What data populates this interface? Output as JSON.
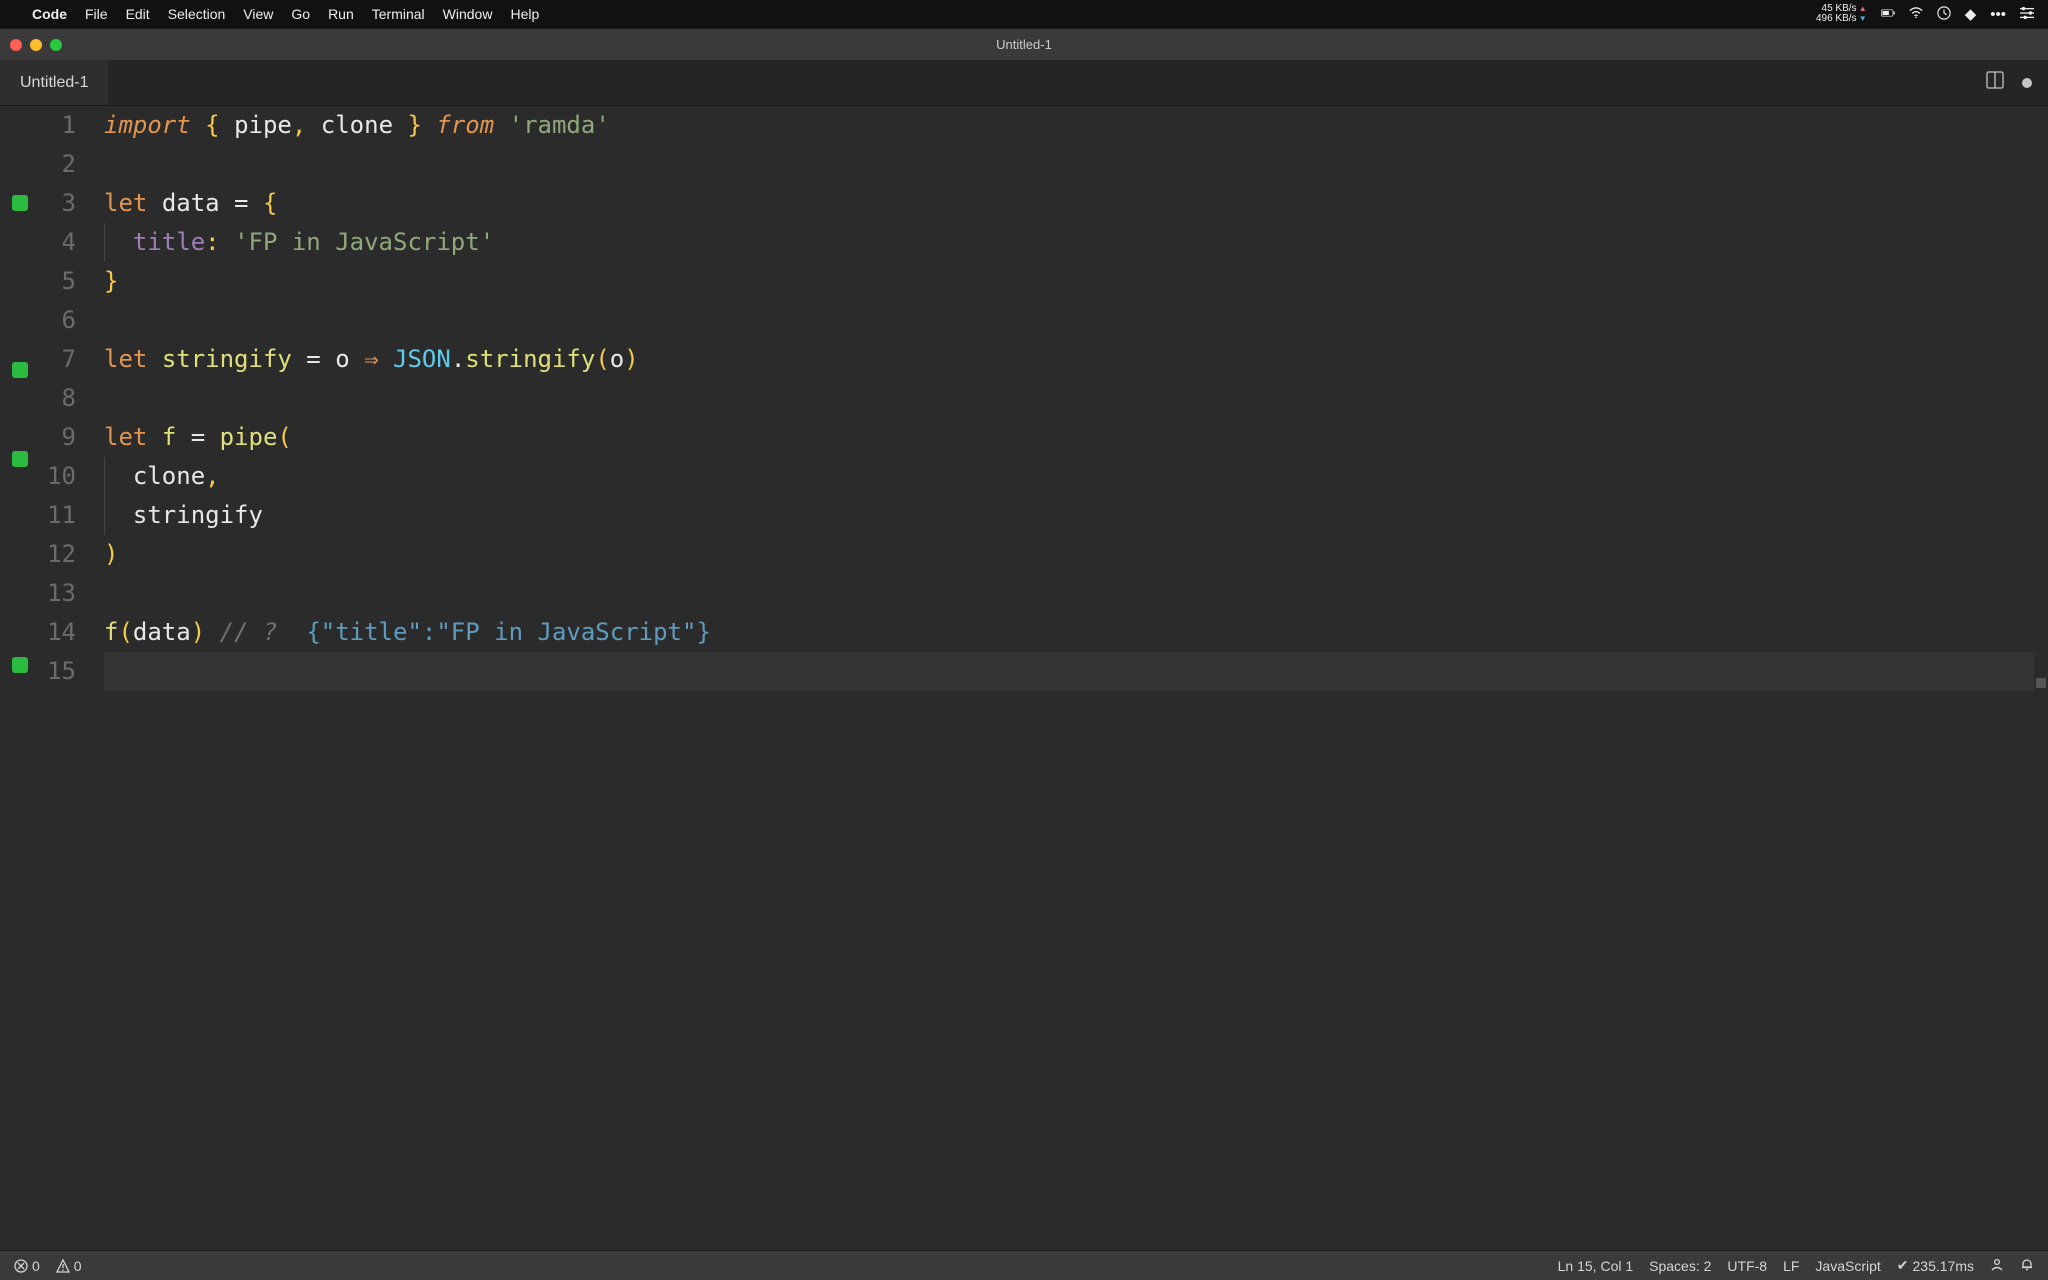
{
  "menubar": {
    "app": "Code",
    "items": [
      "File",
      "Edit",
      "Selection",
      "View",
      "Go",
      "Run",
      "Terminal",
      "Window",
      "Help"
    ],
    "net_up": "45 KB/s",
    "net_down": "496 KB/s"
  },
  "window": {
    "title": "Untitled-1"
  },
  "tabs": {
    "active": "Untitled-1"
  },
  "editor": {
    "lines": [
      {
        "n": 1,
        "mark": false,
        "tokens": [
          [
            "kw",
            "import"
          ],
          [
            "punw",
            " "
          ],
          [
            "pun",
            "{"
          ],
          [
            "punw",
            " "
          ],
          [
            "ident",
            "pipe"
          ],
          [
            "pun",
            ","
          ],
          [
            "punw",
            " "
          ],
          [
            "ident",
            "clone"
          ],
          [
            "punw",
            " "
          ],
          [
            "pun",
            "}"
          ],
          [
            "punw",
            " "
          ],
          [
            "kw",
            "from"
          ],
          [
            "punw",
            " "
          ],
          [
            "str",
            "'ramda'"
          ]
        ]
      },
      {
        "n": 2,
        "mark": false,
        "tokens": []
      },
      {
        "n": 3,
        "mark": true,
        "tokens": [
          [
            "kw2",
            "let"
          ],
          [
            "punw",
            " "
          ],
          [
            "ident",
            "data"
          ],
          [
            "punw",
            " = "
          ],
          [
            "pun",
            "{"
          ]
        ]
      },
      {
        "n": 4,
        "mark": false,
        "indent": 1,
        "tokens": [
          [
            "prop",
            "title"
          ],
          [
            "pun",
            ":"
          ],
          [
            "punw",
            " "
          ],
          [
            "str",
            "'FP in JavaScript'"
          ]
        ]
      },
      {
        "n": 5,
        "mark": false,
        "tokens": [
          [
            "pun",
            "}"
          ]
        ]
      },
      {
        "n": 6,
        "mark": false,
        "tokens": []
      },
      {
        "n": 7,
        "mark": true,
        "tokens": [
          [
            "kw2",
            "let"
          ],
          [
            "punw",
            " "
          ],
          [
            "fn",
            "stringify"
          ],
          [
            "punw",
            " = "
          ],
          [
            "ident",
            "o"
          ],
          [
            "punw",
            " "
          ],
          [
            "arrow",
            "⇒"
          ],
          [
            "punw",
            " "
          ],
          [
            "type",
            "JSON"
          ],
          [
            "punw",
            "."
          ],
          [
            "fn",
            "stringify"
          ],
          [
            "pun",
            "("
          ],
          [
            "ident",
            "o"
          ],
          [
            "pun",
            ")"
          ]
        ]
      },
      {
        "n": 8,
        "mark": false,
        "tokens": []
      },
      {
        "n": 9,
        "mark": true,
        "tokens": [
          [
            "kw2",
            "let"
          ],
          [
            "punw",
            " "
          ],
          [
            "fn",
            "f"
          ],
          [
            "punw",
            " = "
          ],
          [
            "fn",
            "pipe"
          ],
          [
            "pun",
            "("
          ]
        ]
      },
      {
        "n": 10,
        "mark": false,
        "indent": 1,
        "tokens": [
          [
            "ident",
            "clone"
          ],
          [
            "pun",
            ","
          ]
        ]
      },
      {
        "n": 11,
        "mark": false,
        "indent": 1,
        "tokens": [
          [
            "ident",
            "stringify"
          ]
        ]
      },
      {
        "n": 12,
        "mark": false,
        "tokens": [
          [
            "pun",
            ")"
          ]
        ]
      },
      {
        "n": 13,
        "mark": false,
        "tokens": []
      },
      {
        "n": 14,
        "mark": true,
        "tokens": [
          [
            "fn",
            "f"
          ],
          [
            "pun",
            "("
          ],
          [
            "ident",
            "data"
          ],
          [
            "pun",
            ")"
          ],
          [
            "punw",
            " "
          ],
          [
            "cmt",
            "// ?  "
          ],
          [
            "cmtv",
            "{\"title\":\"FP in JavaScript\"}"
          ]
        ]
      },
      {
        "n": 15,
        "mark": false,
        "active": true,
        "tokens": []
      }
    ]
  },
  "status": {
    "errors": "0",
    "warnings": "0",
    "cursor": "Ln 15, Col 1",
    "indent": "Spaces: 2",
    "encoding": "UTF-8",
    "eol": "LF",
    "language": "JavaScript",
    "quokka": "235.17ms"
  }
}
